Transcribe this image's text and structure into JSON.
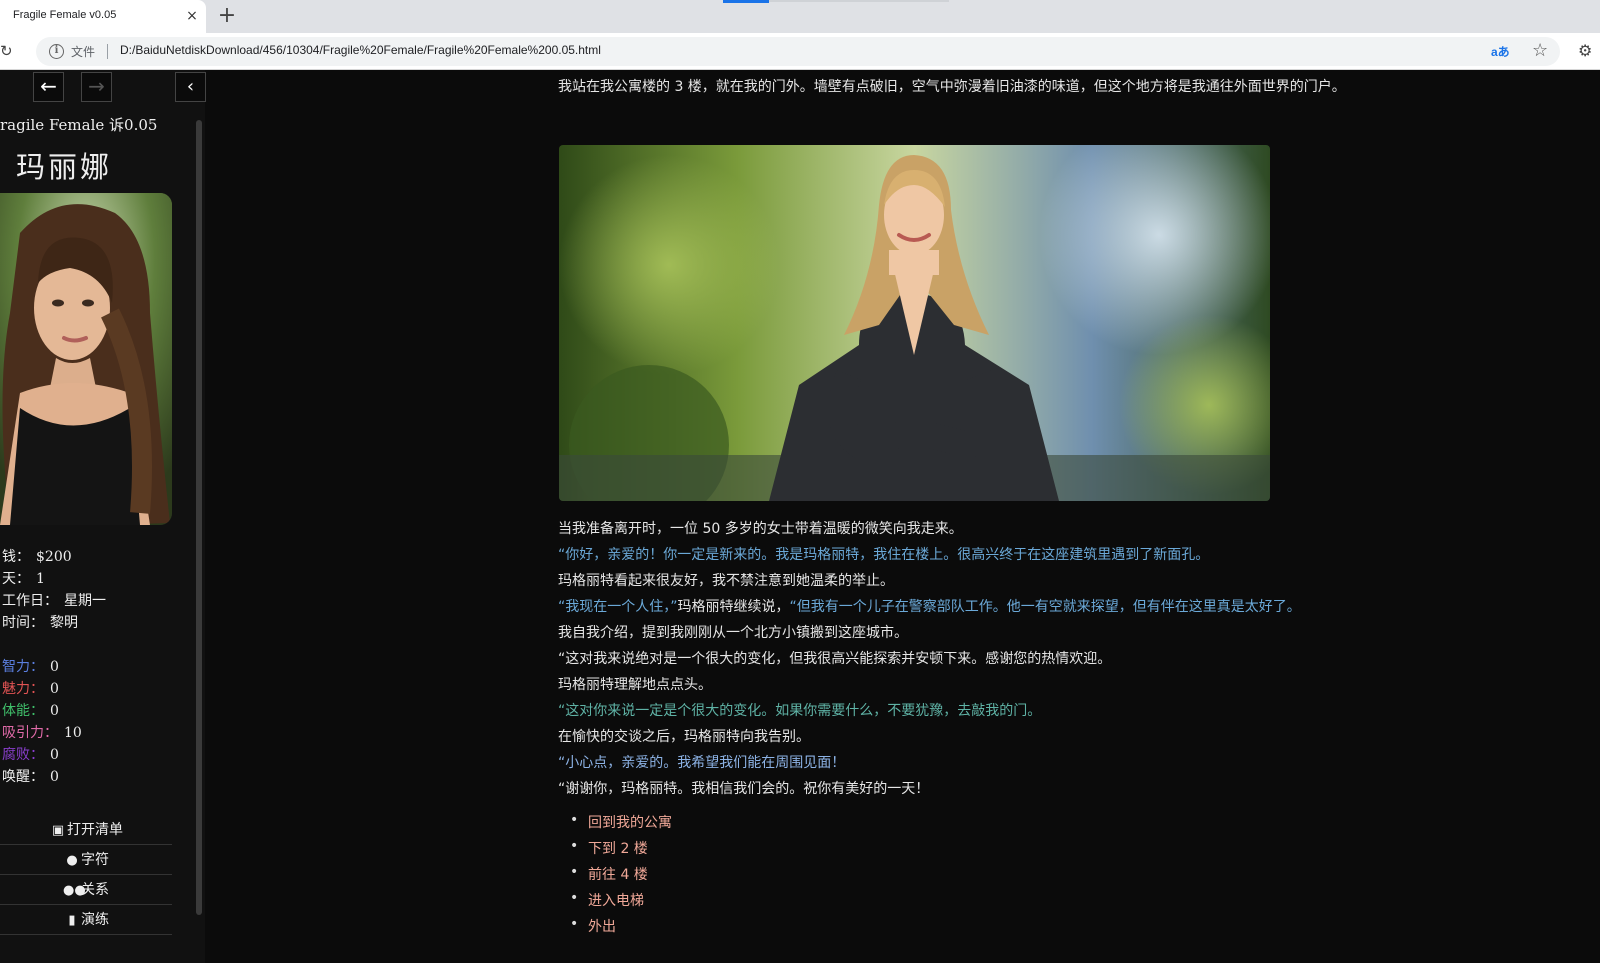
{
  "browser": {
    "tab_title": "Fragile Female v0.05",
    "tab_close": "×",
    "new_tab": "+",
    "file_label": "文件",
    "url": "D:/BaiduNetdiskDownload/456/10304/Fragile%20Female/Fragile%20Female%200.05.html",
    "translate_label": "aあ"
  },
  "sidebar": {
    "back_icon": "←",
    "forward_icon": "→",
    "collapse_icon": "‹",
    "story_title": "ragile Female 诉0.05",
    "character_name": "玛丽娜",
    "stats": [
      {
        "label": "钱：",
        "value": "$200",
        "color": "#eeeeee"
      },
      {
        "label": "天：",
        "value": "1",
        "color": "#eeeeee"
      },
      {
        "label": "工作日：",
        "value": "星期一",
        "color": "#eeeeee"
      },
      {
        "label": "时间：",
        "value": "黎明",
        "color": "#eeeeee"
      }
    ],
    "attributes": [
      {
        "label": "智力：",
        "value": "0",
        "color": "#5b7fe0"
      },
      {
        "label": "魅力：",
        "value": "0",
        "color": "#e05353"
      },
      {
        "label": "体能：",
        "value": "0",
        "color": "#3fbf6a"
      },
      {
        "label": "吸引力：",
        "value": "10",
        "color": "#e06aa8"
      },
      {
        "label": "腐败：",
        "value": "0",
        "color": "#8a3fcf"
      },
      {
        "label": "唤醒：",
        "value": "0",
        "color": "#eeeeee"
      }
    ],
    "menu": [
      {
        "label": "打开清单",
        "icon": "toolbox-icon",
        "glyph": "▣"
      },
      {
        "label": "字符",
        "icon": "user-icon",
        "glyph": "●"
      },
      {
        "label": "关系",
        "icon": "users-icon",
        "glyph": "●●"
      },
      {
        "label": "演练",
        "icon": "book-icon",
        "glyph": "▮"
      }
    ]
  },
  "passage": {
    "intro": "我站在我公寓楼的 3 楼，就在我的门外。墙壁有点破旧，空气中弥漫着旧油漆的味道，但这个地方将是我通往外面世界的门户。",
    "lines": [
      {
        "text": "当我准备离开时，一位 50 多岁的女士带着温暖的微笑向我走来。",
        "style": "narration"
      },
      {
        "text": "“你好，亲爱的！你一定是新来的。我是玛格丽特，我住在楼上。很高兴终于在这座建筑里遇到了新面孔。",
        "style": "speech-blue"
      },
      {
        "text": "玛格丽特看起来很友好，我不禁注意到她温柔的举止。",
        "style": "narration"
      },
      {
        "text_a": "“我现在一个人住，”",
        "text_b": "玛格丽特继续说，",
        "text_c": "“但我有一个儿子在警察部队工作。他一有空就来探望，但有伴在这里真是太好了。",
        "style": "mixed"
      },
      {
        "text": "我自我介绍，提到我刚刚从一个北方小镇搬到这座城市。",
        "style": "narration"
      },
      {
        "text": "“这对我来说绝对是一个很大的变化，但我很高兴能探索并安顿下来。感谢您的热情欢迎。",
        "style": "narration"
      },
      {
        "text": "玛格丽特理解地点点头。",
        "style": "narration"
      },
      {
        "text": "“这对你来说一定是个很大的变化。如果你需要什么，不要犹豫，去敲我的门。",
        "style": "speech-teal"
      },
      {
        "text": "在愉快的交谈之后，玛格丽特向我告别。",
        "style": "narration"
      },
      {
        "text": "“小心点，亲爱的。我希望我们能在周围见面！",
        "style": "speech-violet"
      },
      {
        "text": "“谢谢你，玛格丽特。我相信我们会的。祝你有美好的一天！",
        "style": "narration"
      }
    ],
    "choices": [
      "回到我的公寓",
      "下到 2 楼",
      "前往 4 楼",
      "进入电梯",
      "外出"
    ]
  }
}
